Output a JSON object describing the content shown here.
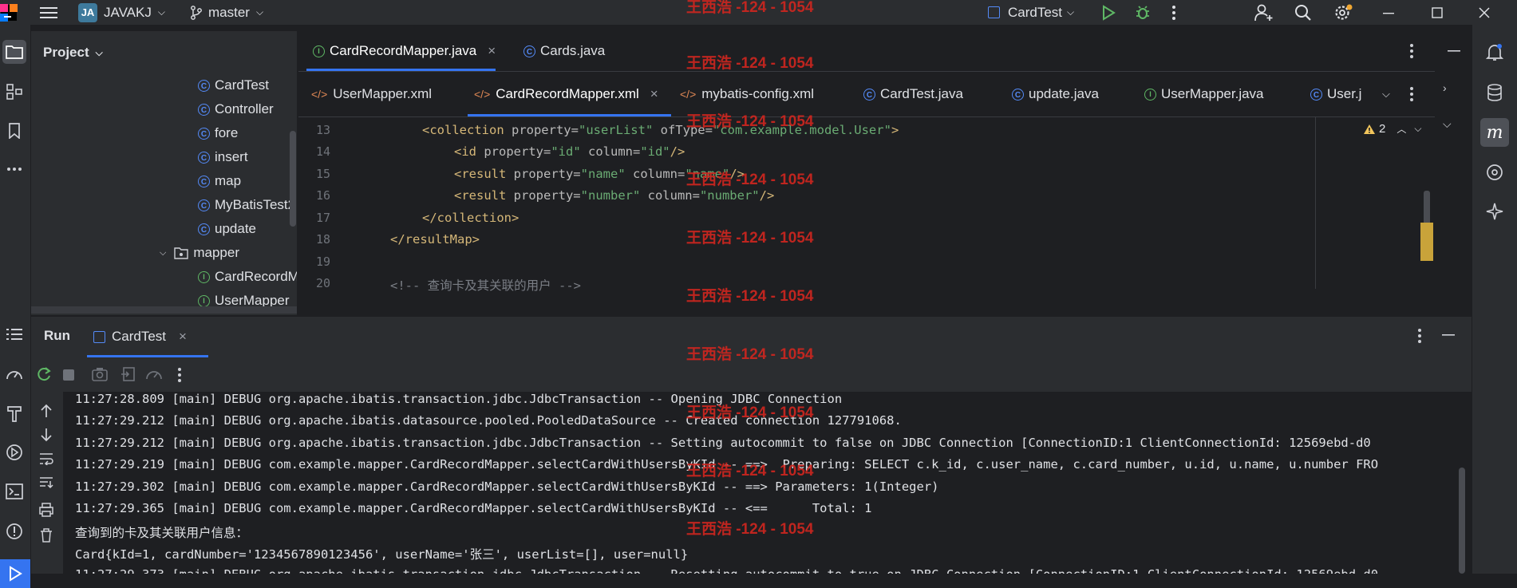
{
  "titlebar": {
    "project_badge": "JA",
    "project_name": "JAVAKJ",
    "branch": "master",
    "run_config": "CardTest"
  },
  "project_panel": {
    "title": "Project",
    "items": [
      {
        "label": "CardTest",
        "kind": "class"
      },
      {
        "label": "Controller",
        "kind": "class"
      },
      {
        "label": "fore",
        "kind": "class"
      },
      {
        "label": "insert",
        "kind": "class"
      },
      {
        "label": "map",
        "kind": "class"
      },
      {
        "label": "MyBatisTest2",
        "kind": "class"
      },
      {
        "label": "update",
        "kind": "class"
      },
      {
        "label": "mapper",
        "kind": "folder"
      },
      {
        "label": "CardRecordMapper",
        "kind": "interface"
      },
      {
        "label": "UserMapper",
        "kind": "interface"
      }
    ]
  },
  "editor": {
    "top_tabs": [
      {
        "label": "CardRecordMapper.java",
        "close": "×"
      },
      {
        "label": "Cards.java"
      }
    ],
    "file_tabs": [
      {
        "label": "UserMapper.xml"
      },
      {
        "label": "CardRecordMapper.xml",
        "close": "×"
      },
      {
        "label": "mybatis-config.xml"
      },
      {
        "label": "CardTest.java"
      },
      {
        "label": "update.java"
      },
      {
        "label": "UserMapper.java"
      },
      {
        "label": "User.j"
      }
    ],
    "warnings": "2",
    "lines": [
      {
        "no": "13"
      },
      {
        "no": "14"
      },
      {
        "no": "15"
      },
      {
        "no": "16"
      },
      {
        "no": "17"
      },
      {
        "no": "18"
      },
      {
        "no": "19"
      },
      {
        "no": "20"
      }
    ],
    "code": {
      "l13_open": "<collection ",
      "l13_a1": "property=",
      "l13_v1": "\"userList\"",
      "l13_a2": " ofType=",
      "l13_v2": "\"com.example.model.User\"",
      "l13_close": ">",
      "l14_open": "<id ",
      "l14_a1": "property=",
      "l14_v1": "\"id\"",
      "l14_a2": " column=",
      "l14_v2": "\"id\"",
      "l14_close": "/>",
      "l15_open": "<result ",
      "l15_a1": "property=",
      "l15_v1": "\"name\"",
      "l15_a2": " column=",
      "l15_v2": "\"name\"",
      "l15_close": "/>",
      "l16_open": "<result ",
      "l16_a1": "property=",
      "l16_v1": "\"number\"",
      "l16_a2": " column=",
      "l16_v2": "\"number\"",
      "l16_close": "/>",
      "l17": "</collection>",
      "l18": "</resultMap>",
      "l20": "<!-- 查询卡及其关联的用户 -->"
    }
  },
  "run_panel": {
    "title": "Run",
    "tab_label": "CardTest",
    "tab_close": "×",
    "console_lines": [
      "11:27:28.809 [main] DEBUG org.apache.ibatis.transaction.jdbc.JdbcTransaction -- Opening JDBC Connection",
      "11:27:29.212 [main] DEBUG org.apache.ibatis.datasource.pooled.PooledDataSource -- Created connection 127791068.",
      "11:27:29.212 [main] DEBUG org.apache.ibatis.transaction.jdbc.JdbcTransaction -- Setting autocommit to false on JDBC Connection [ConnectionID:1 ClientConnectionId: 12569ebd-d0",
      "11:27:29.219 [main] DEBUG com.example.mapper.CardRecordMapper.selectCardWithUsersByKId -- ==>  Preparing: SELECT c.k_id, c.user_name, c.card_number, u.id, u.name, u.number FRO",
      "11:27:29.302 [main] DEBUG com.example.mapper.CardRecordMapper.selectCardWithUsersByKId -- ==> Parameters: 1(Integer)",
      "11:27:29.365 [main] DEBUG com.example.mapper.CardRecordMapper.selectCardWithUsersByKId -- <==      Total: 1",
      "查询到的卡及其关联用户信息：",
      "Card{kId=1, cardNumber='1234567890123456', userName='张三', userList=[], user=null}",
      "11:27:29.373 [main] DEBUG org.apache.ibatis.transaction.jdbc.JdbcTransaction -- Resetting autocommit to true on JDBC Connection [ConnectionID:1 ClientConnectionId: 12569ebd-d0"
    ]
  },
  "watermark": "王西浩 -124 - 1054",
  "colors": {
    "background": "#1e1f22",
    "panel": "#2b2d30",
    "accent": "#3574f0",
    "watermark": "#d1261f",
    "xml_tag": "#d5b778",
    "xml_string": "#6aab73"
  }
}
